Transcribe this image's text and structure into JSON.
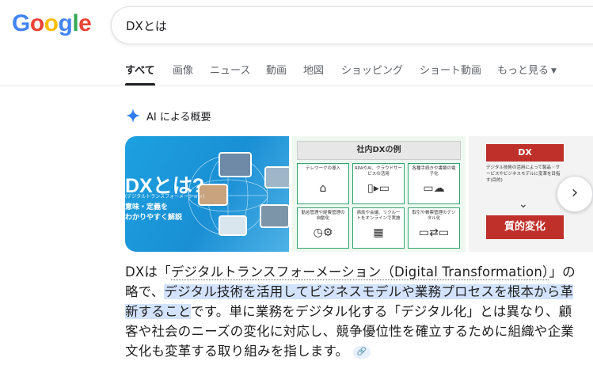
{
  "logo": {
    "letters": [
      "G",
      "o",
      "o",
      "g",
      "l",
      "e"
    ],
    "colors": [
      "#4285F4",
      "#EA4335",
      "#FBBC05",
      "#4285F4",
      "#34A853",
      "#EA4335"
    ]
  },
  "search": {
    "query": "DXとは"
  },
  "tabs": [
    {
      "label": "すべて",
      "active": true
    },
    {
      "label": "画像"
    },
    {
      "label": "ニュース"
    },
    {
      "label": "動画"
    },
    {
      "label": "地図"
    },
    {
      "label": "ショッピング"
    },
    {
      "label": "ショート動画"
    },
    {
      "label": "もっと見る"
    }
  ],
  "ai_overview": {
    "title": "AI による概要",
    "icon": "sparkle-icon",
    "accent": "#4285F4"
  },
  "images": {
    "img1": {
      "title": "DXとは?",
      "subtitle": "(デジタルトランスフォーメーション)",
      "desc1": "意味・定義を",
      "desc2": "わかりやすく解説"
    },
    "img2": {
      "header": "社内DXの例",
      "cells": [
        {
          "label": "テレワークの導入",
          "icon": "house-icon"
        },
        {
          "label": "RPAやAI、クラウドサービスの活用",
          "icon": "document-icon"
        },
        {
          "label": "各種手続きや書類の電子化",
          "icon": "cloud-icon"
        },
        {
          "label": "勤怠管理や経費管理の自動化",
          "icon": "clock-icon"
        },
        {
          "label": "商談や会議、リクルートをオンラインで実施",
          "icon": "meeting-icon"
        },
        {
          "label": "取引や帳票管理のデジタル化",
          "icon": "monitor-icon"
        }
      ]
    },
    "img3": {
      "title": "DX",
      "subtitle": "デジタル技術の活用によって製品・サービスやビジネスモデルに変革を目指す(目的)",
      "bottom": "質的変化"
    }
  },
  "answer": {
    "p1": "DXは「",
    "p2": "デジタルトランスフォーメーション（Digital Transformation）",
    "p3": "」の略で、",
    "p4": "デジタル技術を活用してビジネスモデルや業務プロセスを根本から革新すること",
    "p5": "です。単に業務をデジタル化する「デジタル化」とは異なり、顧客や社会のニーズの変化に対応し、競争優位性を確立するために組織や企業文化も変革する取り組みを指します。"
  }
}
